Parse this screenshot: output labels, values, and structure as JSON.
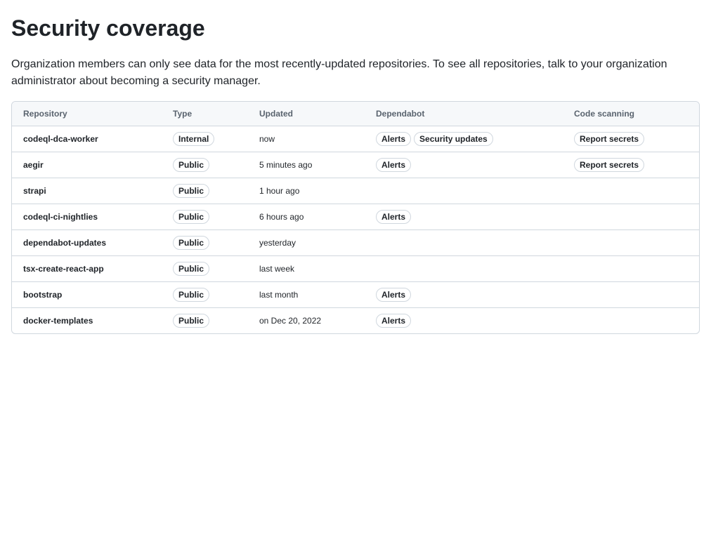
{
  "page": {
    "title": "Security coverage",
    "description": "Organization members can only see data for the most recently-updated repositories. To see all repositories, talk to your organization administrator about becoming a security manager."
  },
  "table": {
    "headers": {
      "repository": "Repository",
      "type": "Type",
      "updated": "Updated",
      "dependabot": "Dependabot",
      "code_scanning": "Code scanning"
    },
    "rows": [
      {
        "repository": "codeql-dca-worker",
        "type": "Internal",
        "updated": "now",
        "dependabot": [
          "Alerts",
          "Security updates"
        ],
        "code_scanning": [
          "Report secrets"
        ]
      },
      {
        "repository": "aegir",
        "type": "Public",
        "updated": "5 minutes ago",
        "dependabot": [
          "Alerts"
        ],
        "code_scanning": [
          "Report secrets"
        ]
      },
      {
        "repository": "strapi",
        "type": "Public",
        "updated": "1 hour ago",
        "dependabot": [],
        "code_scanning": []
      },
      {
        "repository": "codeql-ci-nightlies",
        "type": "Public",
        "updated": "6 hours ago",
        "dependabot": [
          "Alerts"
        ],
        "code_scanning": []
      },
      {
        "repository": "dependabot-updates",
        "type": "Public",
        "updated": "yesterday",
        "dependabot": [],
        "code_scanning": []
      },
      {
        "repository": "tsx-create-react-app",
        "type": "Public",
        "updated": "last week",
        "dependabot": [],
        "code_scanning": []
      },
      {
        "repository": "bootstrap",
        "type": "Public",
        "updated": "last month",
        "dependabot": [
          "Alerts"
        ],
        "code_scanning": []
      },
      {
        "repository": "docker-templates",
        "type": "Public",
        "updated": "on Dec 20, 2022",
        "dependabot": [
          "Alerts"
        ],
        "code_scanning": []
      }
    ]
  },
  "colors": {
    "text": "#1f2328",
    "muted": "#59636e",
    "border": "#d0d7de",
    "header_bg": "#f6f8fa"
  }
}
